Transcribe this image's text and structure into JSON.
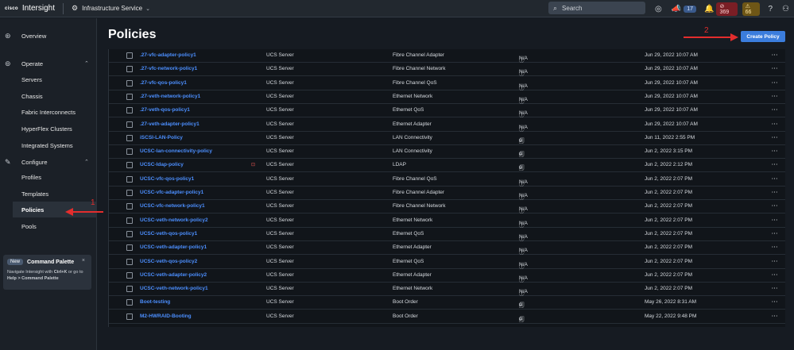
{
  "topbar": {
    "brand": "cisco",
    "app_name": "Intersight",
    "service": "Infrastructure Service",
    "search_placeholder": "Search",
    "announcements_count": "17",
    "critical_count": "369",
    "warning_count": "66"
  },
  "sidebar": {
    "items": [
      {
        "label": "Overview",
        "icon": "dashboard-icon"
      },
      {
        "label": "Operate",
        "icon": "operate-icon"
      },
      {
        "label": "Servers"
      },
      {
        "label": "Chassis"
      },
      {
        "label": "Fabric Interconnects"
      },
      {
        "label": "HyperFlex Clusters"
      },
      {
        "label": "Integrated Systems"
      },
      {
        "label": "Configure",
        "icon": "wrench-icon"
      },
      {
        "label": "Profiles"
      },
      {
        "label": "Templates"
      },
      {
        "label": "Policies"
      },
      {
        "label": "Pools"
      }
    ],
    "command_palette": {
      "badge": "New",
      "title": "Command Palette",
      "desc_1": "Navigate Intersight with ",
      "desc_key": "Ctrl+K",
      "desc_2": " or go to ",
      "desc_help": "Help > Command Palette"
    }
  },
  "main": {
    "title": "Policies",
    "create_button": "Create Policy",
    "rows": [
      {
        "name": ".27-vfc-adapter-policy1",
        "platform": "UCS Server",
        "type": "Fibre Channel Adapter",
        "usage": "N/A",
        "updated": "Jun 29, 2022 10:07 AM"
      },
      {
        "name": ".27-vfc-network-policy1",
        "platform": "UCS Server",
        "type": "Fibre Channel Network",
        "usage": "N/A",
        "updated": "Jun 29, 2022 10:07 AM"
      },
      {
        "name": ".27-vfc-qos-policy1",
        "platform": "UCS Server",
        "type": "Fibre Channel QoS",
        "usage": "N/A",
        "updated": "Jun 29, 2022 10:07 AM"
      },
      {
        "name": ".27-veth-network-policy1",
        "platform": "UCS Server",
        "type": "Ethernet Network",
        "usage": "N/A",
        "updated": "Jun 29, 2022 10:07 AM"
      },
      {
        "name": ".27-veth-qos-policy1",
        "platform": "UCS Server",
        "type": "Ethernet QoS",
        "usage": "N/A",
        "updated": "Jun 29, 2022 10:07 AM"
      },
      {
        "name": ".27-veth-adapter-policy1",
        "platform": "UCS Server",
        "type": "Ethernet Adapter",
        "usage": "N/A",
        "updated": "Jun 29, 2022 10:07 AM"
      },
      {
        "name": "iSCSI-LAN-Policy",
        "platform": "UCS Server",
        "type": "LAN Connectivity",
        "usage": "0",
        "updated": "Jun 11, 2022 2:55 PM"
      },
      {
        "name": "UCSC-lan-connectivity-policy",
        "platform": "UCS Server",
        "type": "LAN Connectivity",
        "usage": "0",
        "updated": "Jun 2, 2022 3:15 PM"
      },
      {
        "name": "UCSC-ldap-policy",
        "platform": "UCS Server",
        "type": "LDAP",
        "usage": "0",
        "updated": "Jun 2, 2022 2:12 PM"
      },
      {
        "name": "UCSC-vfc-qos-policy1",
        "platform": "UCS Server",
        "type": "Fibre Channel QoS",
        "usage": "N/A",
        "updated": "Jun 2, 2022 2:07 PM"
      },
      {
        "name": "UCSC-vfc-adapter-policy1",
        "platform": "UCS Server",
        "type": "Fibre Channel Adapter",
        "usage": "N/A",
        "updated": "Jun 2, 2022 2:07 PM"
      },
      {
        "name": "UCSC-vfc-network-policy1",
        "platform": "UCS Server",
        "type": "Fibre Channel Network",
        "usage": "N/A",
        "updated": "Jun 2, 2022 2:07 PM"
      },
      {
        "name": "UCSC-veth-network-policy2",
        "platform": "UCS Server",
        "type": "Ethernet Network",
        "usage": "N/A",
        "updated": "Jun 2, 2022 2:07 PM"
      },
      {
        "name": "UCSC-veth-qos-policy1",
        "platform": "UCS Server",
        "type": "Ethernet QoS",
        "usage": "N/A",
        "updated": "Jun 2, 2022 2:07 PM"
      },
      {
        "name": "UCSC-veth-adapter-policy1",
        "platform": "UCS Server",
        "type": "Ethernet Adapter",
        "usage": "N/A",
        "updated": "Jun 2, 2022 2:07 PM"
      },
      {
        "name": "UCSC-veth-qos-policy2",
        "platform": "UCS Server",
        "type": "Ethernet QoS",
        "usage": "N/A",
        "updated": "Jun 2, 2022 2:07 PM"
      },
      {
        "name": "UCSC-veth-adapter-policy2",
        "platform": "UCS Server",
        "type": "Ethernet Adapter",
        "usage": "N/A",
        "updated": "Jun 2, 2022 2:07 PM"
      },
      {
        "name": "UCSC-veth-network-policy1",
        "platform": "UCS Server",
        "type": "Ethernet Network",
        "usage": "N/A",
        "updated": "Jun 2, 2022 2:07 PM"
      },
      {
        "name": "Boot-testing",
        "platform": "UCS Server",
        "type": "Boot Order",
        "usage": "0",
        "updated": "May 26, 2022 8:31 AM"
      },
      {
        "name": "M2-HWRAID-Booting",
        "platform": "UCS Server",
        "type": "Boot Order",
        "usage": "0",
        "updated": "May 22, 2022 9:48 PM"
      }
    ]
  },
  "annotations": {
    "marker_1": "1",
    "marker_2": "2"
  },
  "colors": {
    "accent": "#3b7ddd",
    "link": "#4c8fff",
    "annotation": "#e32d2d"
  }
}
